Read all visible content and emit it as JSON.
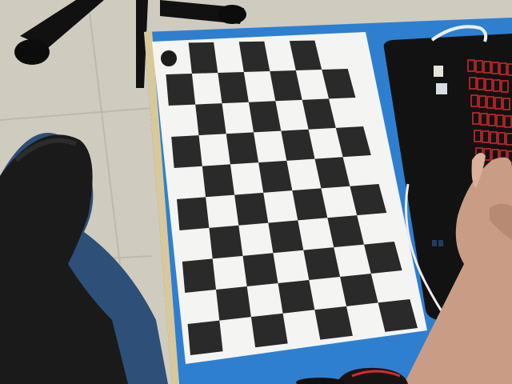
{
  "scene": {
    "description_free": true,
    "board": {
      "rows": 10,
      "cols": 7,
      "marker": "round-black-sticker"
    },
    "colors": {
      "floor": "#cfcbbf",
      "floor_tile_line": "#bdb9ad",
      "table_blue": "#2f7fd0",
      "table_edge": "#d9c89a",
      "paper": "#f4f5f2",
      "square_dark": "#2a2a2a",
      "laptop": "#121212",
      "keyboard_backlight": "#d8282c",
      "skin": "#c99c86",
      "jeans": "#2d4f78",
      "black_pants": "#1a1a1a",
      "cable": "#eeeeee"
    }
  }
}
